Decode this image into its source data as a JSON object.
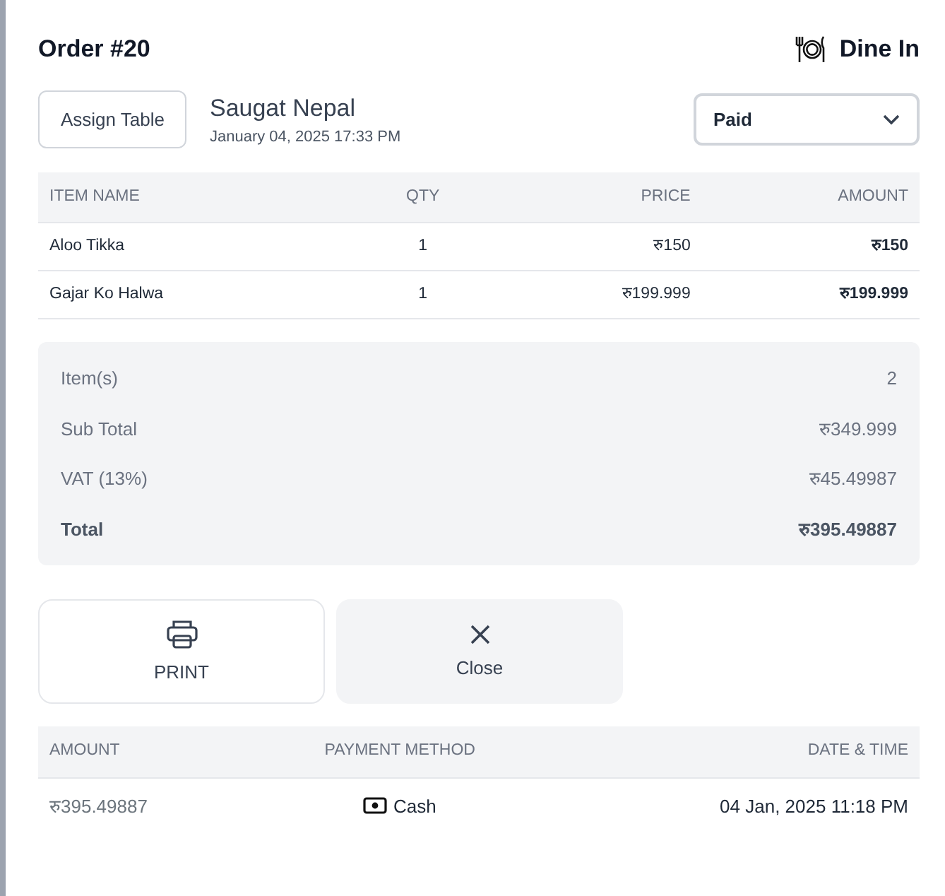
{
  "order": {
    "title": "Order #20",
    "service": "Dine In",
    "assign_button": "Assign Table",
    "customer": "Saugat Nepal",
    "date": "January 04, 2025 17:33 PM",
    "status": "Paid"
  },
  "items_table": {
    "columns": [
      "ITEM NAME",
      "QTY",
      "PRICE",
      "AMOUNT"
    ],
    "rows": [
      [
        "Aloo Tikka",
        "1",
        "रु150",
        "रु150"
      ],
      [
        "Gajar Ko Halwa",
        "1",
        "रु199.999",
        "रु199.999"
      ]
    ]
  },
  "summary": [
    {
      "label": "Item(s)",
      "value": "2",
      "total": false
    },
    {
      "label": "Sub Total",
      "value": "रु349.999",
      "total": false
    },
    {
      "label": "VAT (13%)",
      "value": "रु45.49987",
      "total": false
    },
    {
      "label": "Total",
      "value": "रु395.49887",
      "total": true
    }
  ],
  "actions": [
    {
      "label": "PRINT",
      "kind": "print"
    },
    {
      "label": "Close",
      "kind": "close"
    }
  ],
  "payments_table": {
    "columns": [
      "AMOUNT",
      "PAYMENT METHOD",
      "DATE & TIME"
    ],
    "rows": [
      {
        "amount": "रु395.49887",
        "method": "Cash",
        "date": "04 Jan, 2025 11:18 PM"
      }
    ]
  }
}
